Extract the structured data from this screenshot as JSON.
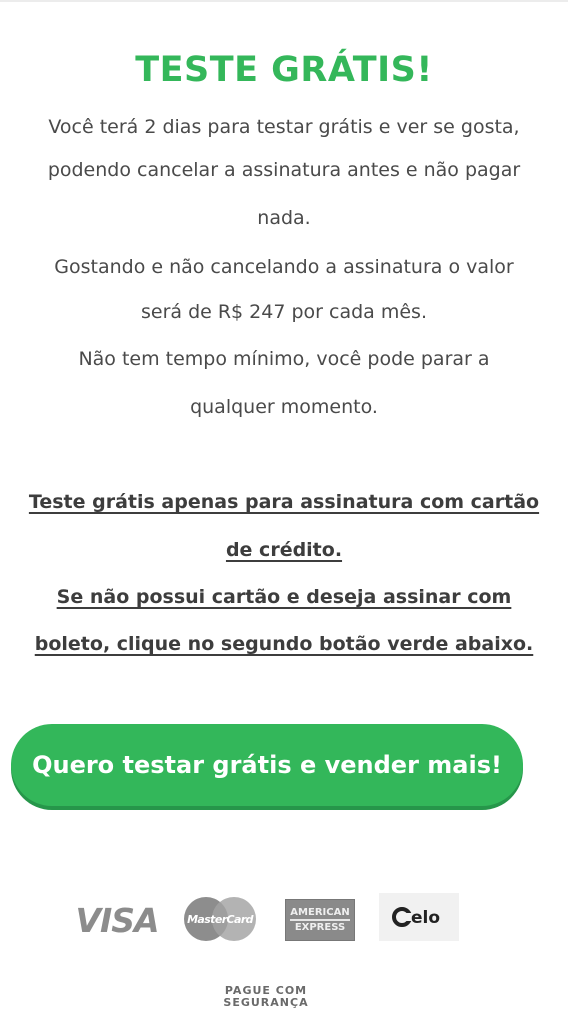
{
  "offer": {
    "title": "TESTE GRÁTIS!",
    "lines": [
      "Você terá 2 dias para testar grátis e ver se gosta,",
      "podendo cancelar a assinatura antes e não pagar",
      "nada.",
      "Gostando e não cancelando a assinatura o valor",
      "será de R$ 247 por cada mês.",
      "Não tem tempo mínimo, você pode parar a",
      "qualquer momento."
    ],
    "notice": [
      "Teste grátis apenas para assinatura com cartão",
      "de crédito.",
      "Se não possui cartão e deseja assinar com",
      "boleto, clique no segundo botão verde abaixo."
    ]
  },
  "cta": {
    "label": "Quero testar grátis e vender mais!"
  },
  "payment": {
    "brands": {
      "visa": "VISA",
      "mastercard": "MasterCard",
      "amex_line1": "AMERICAN",
      "amex_line2": "EXPRESS",
      "elo": "elo"
    },
    "icons": [
      "visa-logo-icon",
      "mastercard-logo-icon",
      "amex-logo-icon",
      "elo-logo-icon"
    ],
    "secure_line1": "PAGUE COM",
    "secure_line2": "SEGURANÇA"
  },
  "colors": {
    "brand_green": "#34b75a",
    "text": "#4a4a4a"
  }
}
